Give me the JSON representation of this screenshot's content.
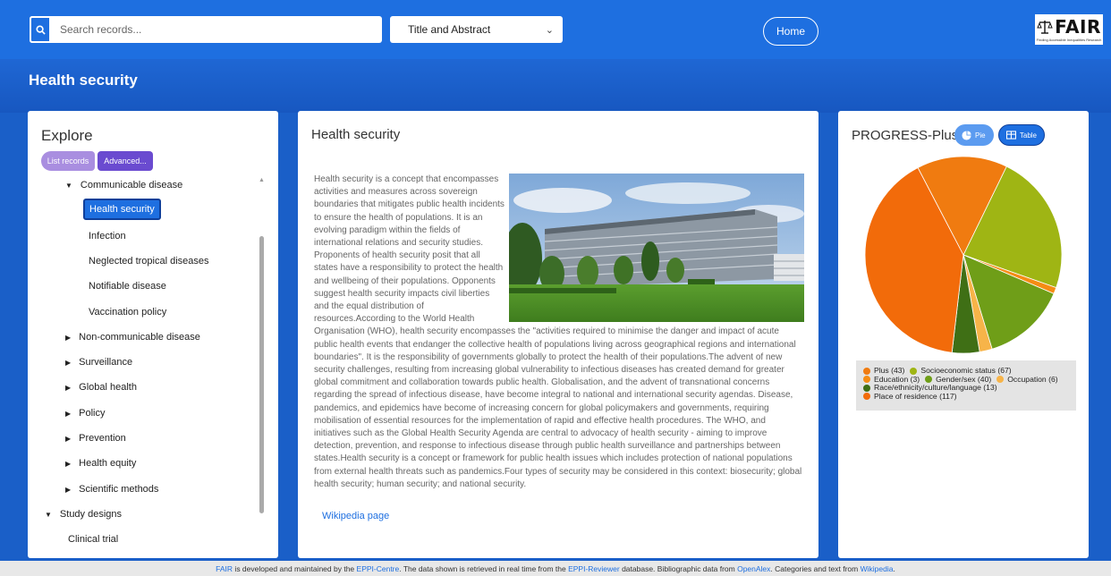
{
  "topbar": {
    "search_placeholder": "Search records...",
    "search_field": "Title and Abstract",
    "home_label": "Home",
    "logo_text": "FAIR",
    "logo_sub": "Finding Accessible Inequalities Research"
  },
  "page_title": "Health security",
  "explore": {
    "title": "Explore",
    "list_records": "List records",
    "advanced": "Advanced...",
    "tree": [
      {
        "label": "Communicable disease",
        "level": 1,
        "expanded": true
      },
      {
        "label": "Health security",
        "level": 2,
        "active": true
      },
      {
        "label": "Infection",
        "level": 2
      },
      {
        "label": "Neglected tropical diseases",
        "level": 2
      },
      {
        "label": "Notifiable disease",
        "level": 2
      },
      {
        "label": "Vaccination policy",
        "level": 2
      },
      {
        "label": "Non-communicable disease",
        "level": 1,
        "expanded": false
      },
      {
        "label": "Surveillance",
        "level": 1,
        "expanded": false
      },
      {
        "label": "Global health",
        "level": 1,
        "expanded": false
      },
      {
        "label": "Policy",
        "level": 1,
        "expanded": false
      },
      {
        "label": "Prevention",
        "level": 1,
        "expanded": false
      },
      {
        "label": "Health equity",
        "level": 1,
        "expanded": false
      },
      {
        "label": "Scientific methods",
        "level": 1,
        "expanded": false
      },
      {
        "label": "Study designs",
        "level": 0,
        "expanded": true
      },
      {
        "label": "Clinical trial",
        "level": 1
      }
    ]
  },
  "article": {
    "title": "Health security",
    "text": "Health security is a concept that encompasses activities and measures across sovereign boundaries that mitigates public health incidents to ensure the health of populations. It is an evolving paradigm within the fields of international relations and security studies. Proponents of health security posit that all states have a responsibility to protect the health and wellbeing of their populations. Opponents suggest health security impacts civil liberties and the equal distribution of resources.According to the World Health Organisation (WHO), health security encompasses the \"activities required to minimise the danger and impact of acute public health events that endanger the collective health of populations living across geographical regions and international boundaries\". It is the responsibility of governments globally to protect the health of their populations.The advent of new security challenges, resulting from increasing global vulnerability to infectious diseases has created demand for greater global commitment and collaboration towards public health. Globalisation, and the advent of transnational concerns regarding the spread of infectious disease, have become integral to national and international security agendas. Disease, pandemics, and epidemics have become of increasing concern for global policymakers and governments, requiring mobilisation of essential resources for the implementation of rapid and effective health procedures. The WHO, and initiatives such as the Global Health Security Agenda are central to advocacy of health security - aiming to improve detection, prevention, and response to infectious disease through public health surveillance and partnerships between states.Health security is a concept or framework for public health issues which includes protection of national populations from external health threats such as pandemics.Four types of security may be considered in this context: biosecurity; global health security; human security; and national security.",
    "wiki_link": "Wikipedia page"
  },
  "progress": {
    "title": "PROGRESS-Plus",
    "pie_label": "Pie",
    "table_label": "Table"
  },
  "chart_data": {
    "type": "pie",
    "title": "",
    "series": [
      {
        "name": "Plus",
        "value": 43,
        "color": "#f07b10"
      },
      {
        "name": "Socioeconomic status",
        "value": 67,
        "color": "#9fb514"
      },
      {
        "name": "Education",
        "value": 3,
        "color": "#f58c14"
      },
      {
        "name": "Gender/sex",
        "value": 40,
        "color": "#6f9e18"
      },
      {
        "name": "Occupation",
        "value": 6,
        "color": "#f7b449"
      },
      {
        "name": "Race/ethnicity/culture/language",
        "value": 13,
        "color": "#3f6f15"
      },
      {
        "name": "Place of residence",
        "value": 117,
        "color": "#f26b0a"
      }
    ],
    "legend_labels": [
      "Plus (43)",
      "Socioeconomic status (67)",
      "Education (3)",
      "Gender/sex (40)",
      "Occupation (6)",
      "Race/ethnicity/culture/language (13)",
      "Place of residence (117)"
    ],
    "legend_position": "bottom"
  },
  "footer": {
    "fair": "FAIR",
    "t1": " is developed and maintained by the ",
    "eppi_centre": "EPPI-Centre",
    "t2": ". The data shown is retrieved in real time from the ",
    "eppi_reviewer": "EPPI-Reviewer",
    "t3": " database. Bibliographic data from ",
    "openalex": "OpenAlex",
    "t4": ". Categories and text from ",
    "wikipedia": "Wikipedia",
    "t5": "."
  }
}
